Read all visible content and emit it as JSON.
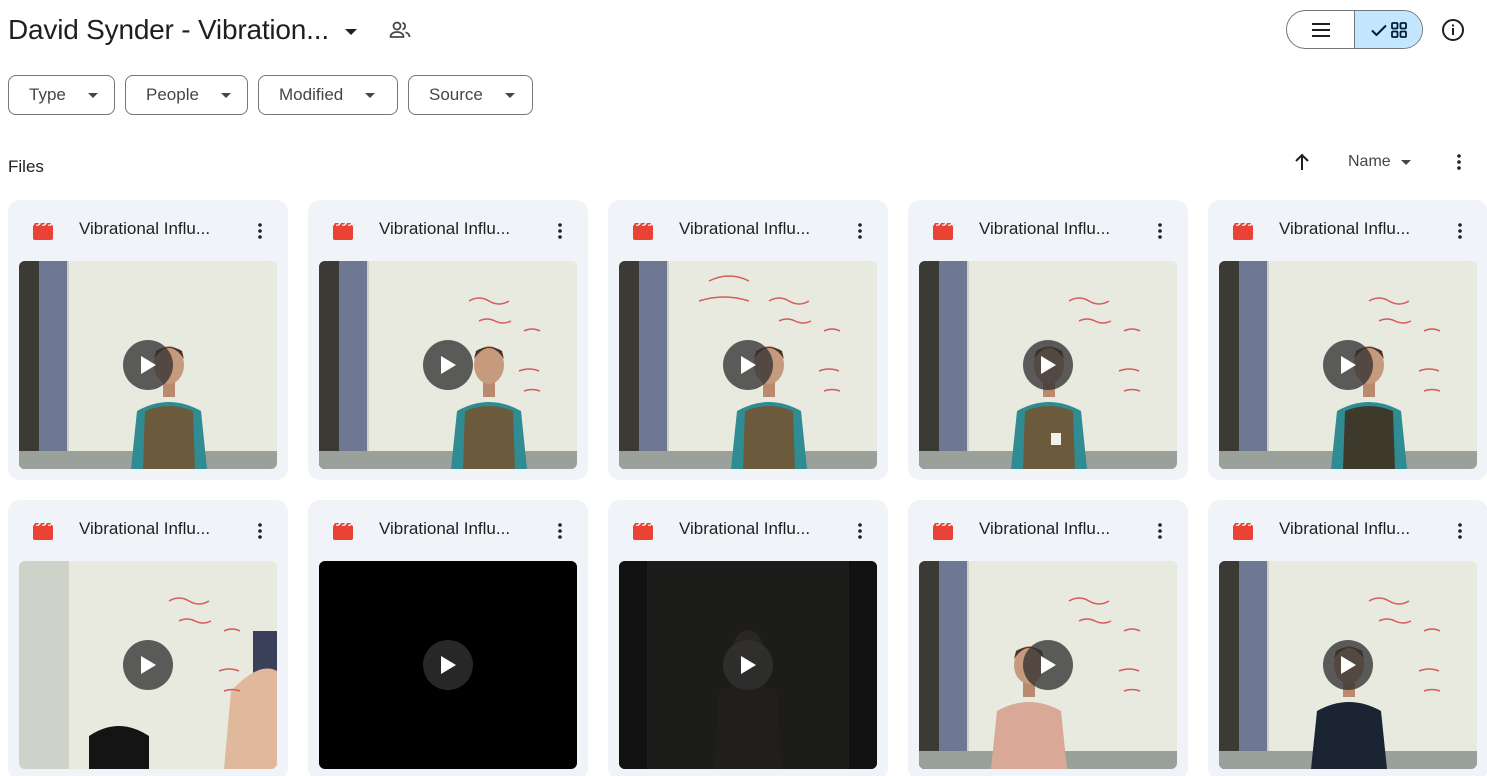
{
  "header": {
    "folder_title": "David Synder - Vibration..."
  },
  "view": {
    "list_icon": "list-icon",
    "grid_icon": "grid-icon",
    "selected": "grid"
  },
  "filters": [
    {
      "label": "Type"
    },
    {
      "label": "People"
    },
    {
      "label": "Modified"
    },
    {
      "label": "Source"
    }
  ],
  "section": {
    "label": "Files",
    "sort_label": "Name"
  },
  "colors": {
    "accent_selected": "#c2e7ff",
    "card_bg": "#f0f4f9",
    "video_icon": "#ea4335"
  },
  "files": [
    {
      "name": "Vibrational Influ...",
      "thumb": "person-vest"
    },
    {
      "name": "Vibrational Influ...",
      "thumb": "person-arms-crossed"
    },
    {
      "name": "Vibrational Influ...",
      "thumb": "person-whiteboard-notes"
    },
    {
      "name": "Vibrational Influ...",
      "thumb": "person-holding-cup"
    },
    {
      "name": "Vibrational Influ...",
      "thumb": "person-head-down"
    },
    {
      "name": "Vibrational Influ...",
      "thumb": "whiteboard-chair"
    },
    {
      "name": "Vibrational Influ...",
      "thumb": "black"
    },
    {
      "name": "Vibrational Influ...",
      "thumb": "dark-room"
    },
    {
      "name": "Vibrational Influ...",
      "thumb": "person-pink-shirt"
    },
    {
      "name": "Vibrational Influ...",
      "thumb": "person-dark-shirt"
    }
  ]
}
